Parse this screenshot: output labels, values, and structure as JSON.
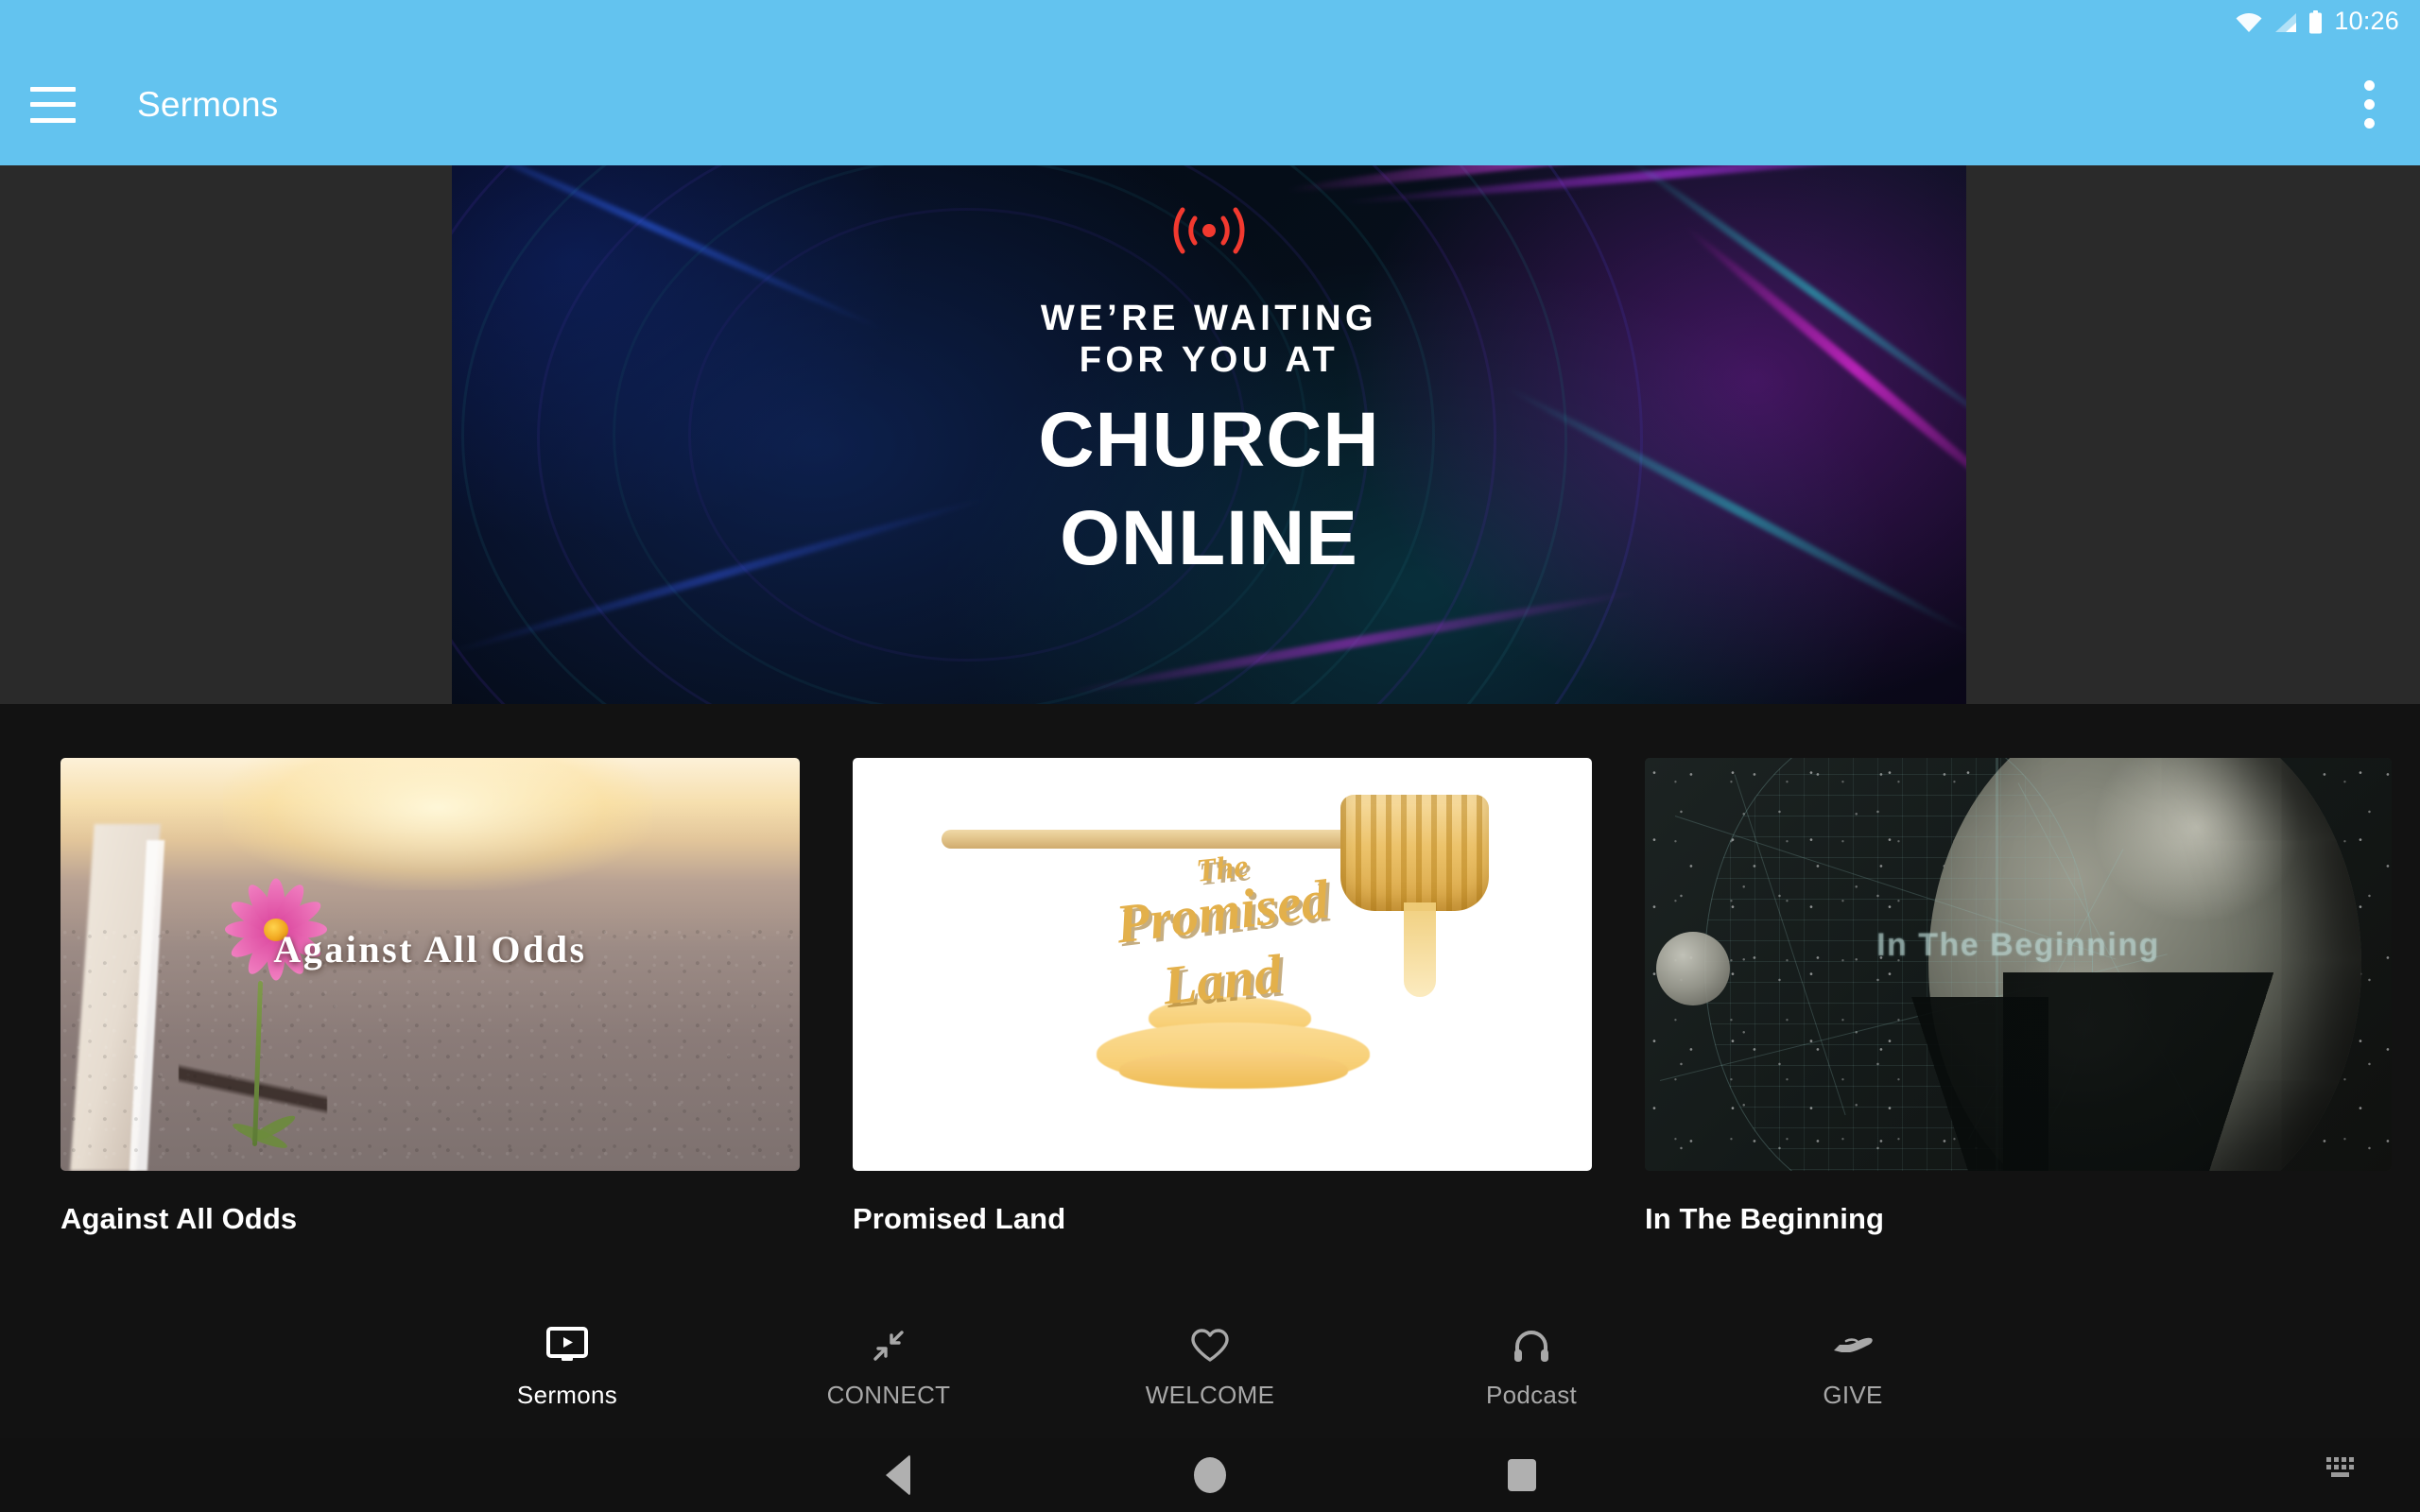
{
  "status_bar": {
    "time": "10:26",
    "icons": [
      "wifi-icon",
      "cellular-signal-icon",
      "battery-icon"
    ],
    "background": "#63c3ef"
  },
  "app_bar": {
    "menu_icon": "hamburger-menu-icon",
    "title": "Sermons",
    "overflow_icon": "more-vertical-icon",
    "background": "#63c3ef",
    "text_color": "#ffffff"
  },
  "hero": {
    "live_icon": "live-broadcast-icon",
    "live_icon_color": "#f2392f",
    "kicker_line1": "WE’RE WAITING",
    "kicker_line2": "FOR YOU AT",
    "headline_line1": "CHURCH",
    "headline_line2": "ONLINE",
    "letterbox_color": "#2a2a2a"
  },
  "series_cards": [
    {
      "title": "Against All Odds",
      "thumb_overlay_text": "Against All Odds",
      "thumb_art": "road-with-pink-flower-photo"
    },
    {
      "title": "Promised Land",
      "thumb_overlay_line1": "The",
      "thumb_overlay_line2": "Promised",
      "thumb_overlay_line3": "Land",
      "thumb_art": "honey-dipper-photo"
    },
    {
      "title": "In The Beginning",
      "thumb_overlay_text": "In The Beginning",
      "thumb_art": "earth-and-moon-star-chart-photo"
    }
  ],
  "bottom_nav": {
    "items": [
      {
        "label": "Sermons",
        "icon": "tv-play-icon",
        "active": true
      },
      {
        "label": "CONNECT",
        "icon": "compress-arrows-icon",
        "active": false
      },
      {
        "label": "WELCOME",
        "icon": "heart-outline-icon",
        "active": false
      },
      {
        "label": "Podcast",
        "icon": "headphones-icon",
        "active": false
      },
      {
        "label": "GIVE",
        "icon": "open-hand-icon",
        "active": false
      }
    ],
    "active_color": "#ffffff",
    "inactive_color": "#a8a8a8",
    "background": "#121212"
  },
  "system_nav": {
    "back_icon": "triangle-back-icon",
    "home_icon": "circle-home-icon",
    "recents_icon": "square-recents-icon",
    "ime_icon": "keyboard-icon"
  }
}
